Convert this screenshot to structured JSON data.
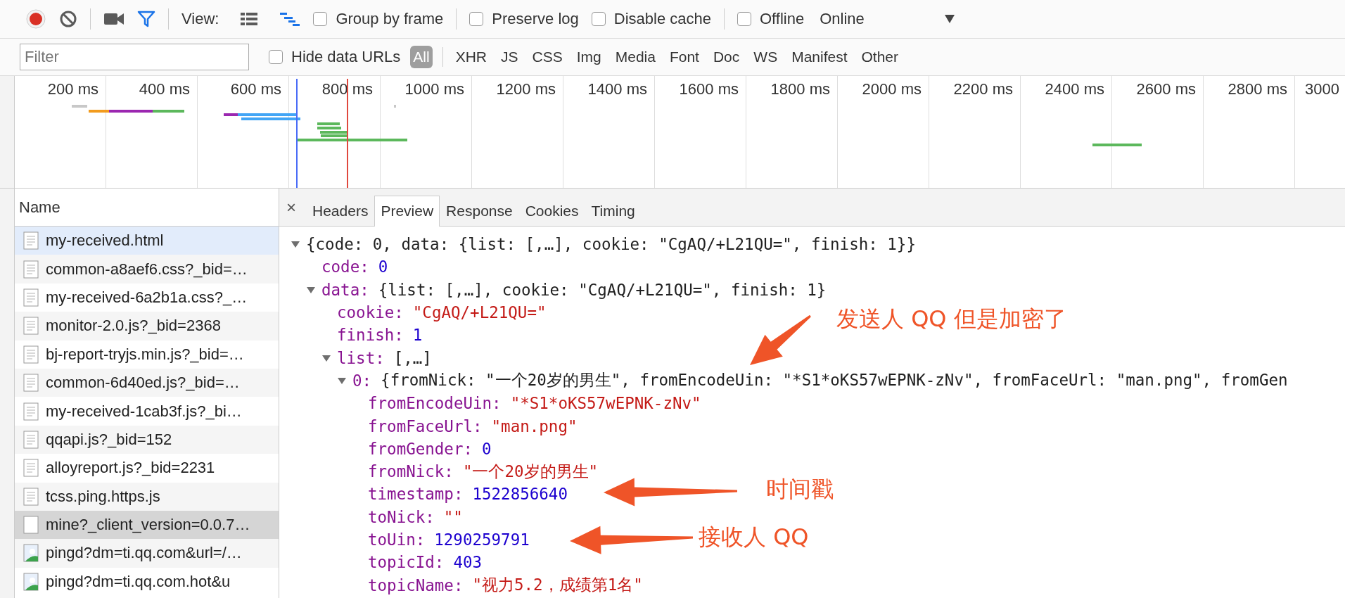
{
  "toolbar": {
    "record": {
      "on": true
    },
    "view_label": "View:",
    "view_modes": [
      {
        "kind": "list",
        "on": false
      },
      {
        "kind": "waterfall",
        "on": true
      }
    ],
    "options": [
      {
        "label": "Group by frame",
        "checked": false
      },
      {
        "label": "Preserve log",
        "checked": false
      },
      {
        "label": "Disable cache",
        "checked": false
      },
      {
        "label": "Offline",
        "checked": false
      }
    ],
    "throttling": "Online"
  },
  "filter_bar": {
    "placeholder": "Filter",
    "hide_data_urls": {
      "label": "Hide data URLs",
      "checked": false
    },
    "types": [
      {
        "label": "All",
        "selected": true
      },
      {
        "label": "XHR",
        "selected": false
      },
      {
        "label": "JS",
        "selected": false
      },
      {
        "label": "CSS",
        "selected": false
      },
      {
        "label": "Img",
        "selected": false
      },
      {
        "label": "Media",
        "selected": false
      },
      {
        "label": "Font",
        "selected": false
      },
      {
        "label": "Doc",
        "selected": false
      },
      {
        "label": "WS",
        "selected": false
      },
      {
        "label": "Manifest",
        "selected": false
      },
      {
        "label": "Other",
        "selected": false
      }
    ]
  },
  "timeline": {
    "ticks": [
      "200 ms",
      "400 ms",
      "600 ms",
      "800 ms",
      "1000 ms",
      "1200 ms",
      "1400 ms",
      "1600 ms",
      "1800 ms",
      "2000 ms",
      "2200 ms",
      "2400 ms",
      "2600 ms",
      "2800 ms",
      "3000"
    ]
  },
  "requests": {
    "header": "Name",
    "rows": [
      {
        "name": "my-received.html",
        "kind": "document",
        "selected": false,
        "hovered": true
      },
      {
        "name": "common-a8aef6.css?_bid=…",
        "kind": "document",
        "selected": false,
        "hovered": false
      },
      {
        "name": "my-received-6a2b1a.css?_…",
        "kind": "document",
        "selected": false,
        "hovered": false
      },
      {
        "name": "monitor-2.0.js?_bid=2368",
        "kind": "document",
        "selected": false,
        "hovered": false
      },
      {
        "name": "bj-report-tryjs.min.js?_bid=…",
        "kind": "document",
        "selected": false,
        "hovered": false
      },
      {
        "name": "common-6d40ed.js?_bid=…",
        "kind": "document",
        "selected": false,
        "hovered": false
      },
      {
        "name": "my-received-1cab3f.js?_bi…",
        "kind": "document",
        "selected": false,
        "hovered": false
      },
      {
        "name": "qqapi.js?_bid=152",
        "kind": "document",
        "selected": false,
        "hovered": false
      },
      {
        "name": "alloyreport.js?_bid=2231",
        "kind": "document",
        "selected": false,
        "hovered": false
      },
      {
        "name": "tcss.ping.https.js",
        "kind": "document",
        "selected": false,
        "hovered": false
      },
      {
        "name": "mine?_client_version=0.0.7…",
        "kind": "blank",
        "selected": true,
        "hovered": false
      },
      {
        "name": "pingd?dm=ti.qq.com&url=/…",
        "kind": "image",
        "selected": false,
        "hovered": false
      },
      {
        "name": "pingd?dm=ti.qq.com.hot&u",
        "kind": "image",
        "selected": false,
        "hovered": false
      }
    ]
  },
  "details": {
    "close": "×",
    "tabs": [
      {
        "label": "Headers",
        "selected": false
      },
      {
        "label": "Preview",
        "selected": true
      },
      {
        "label": "Response",
        "selected": false
      },
      {
        "label": "Cookies",
        "selected": false
      },
      {
        "label": "Timing",
        "selected": false
      }
    ],
    "preview": {
      "summary": "{code: 0, data: {list: [,…], cookie: \"CgAQ/+L21QU=\", finish: 1}}",
      "expanded": true,
      "children": [
        {
          "key": "code:",
          "value": "0",
          "kind": "number"
        },
        {
          "key": "data:",
          "summary": "{list: [,…], cookie: \"CgAQ/+L21QU=\", finish: 1}",
          "expanded": true,
          "children": [
            {
              "key": "cookie:",
              "value": "\"CgAQ/+L21QU=\"",
              "kind": "string"
            },
            {
              "key": "finish:",
              "value": "1",
              "kind": "number"
            },
            {
              "key": "list:",
              "summary": "[,…]",
              "expanded": true,
              "children": [
                {
                  "key": "0:",
                  "summary": "{fromNick: \"一个20岁的男生\", fromEncodeUin: \"*S1*oKS57wEPNK-zNv\", fromFaceUrl: \"man.png\", fromGen",
                  "expanded": true,
                  "children": [
                    {
                      "key": "fromEncodeUin:",
                      "value": "\"*S1*oKS57wEPNK-zNv\"",
                      "kind": "string"
                    },
                    {
                      "key": "fromFaceUrl:",
                      "value": "\"man.png\"",
                      "kind": "string"
                    },
                    {
                      "key": "fromGender:",
                      "value": "0",
                      "kind": "number"
                    },
                    {
                      "key": "fromNick:",
                      "value": "\"一个20岁的男生\"",
                      "kind": "string"
                    },
                    {
                      "key": "timestamp:",
                      "value": "1522856640",
                      "kind": "number"
                    },
                    {
                      "key": "toNick:",
                      "value": "\"\"",
                      "kind": "string"
                    },
                    {
                      "key": "toUin:",
                      "value": "1290259791",
                      "kind": "number"
                    },
                    {
                      "key": "topicId:",
                      "value": "403",
                      "kind": "number"
                    },
                    {
                      "key": "topicName:",
                      "value": "\"视力5.2，成绩第1名\"",
                      "kind": "string"
                    }
                  ]
                }
              ]
            }
          ]
        }
      ]
    }
  },
  "annotations": [
    {
      "text": "发送人 QQ 但是加密了"
    },
    {
      "text": "时间戳"
    },
    {
      "text": "接收人 QQ"
    }
  ]
}
